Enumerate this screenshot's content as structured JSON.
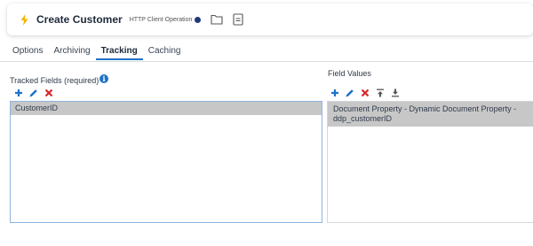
{
  "header": {
    "title": "Create Customer",
    "subtitle": "HTTP Client Operation"
  },
  "tabs": [
    {
      "label": "Options",
      "active": false
    },
    {
      "label": "Archiving",
      "active": false
    },
    {
      "label": "Tracking",
      "active": true
    },
    {
      "label": "Caching",
      "active": false
    }
  ],
  "tracked_fields": {
    "label": "Tracked Fields (required)",
    "items": [
      "CustomerID"
    ]
  },
  "field_values": {
    "label": "Field Values",
    "items": [
      "Document Property - Dynamic Document Property - ddp_customerID"
    ]
  },
  "colors": {
    "accent": "#1e72c8",
    "bolt": "#f5b400",
    "delete": "#d9262c",
    "selected_row": "#c7c7c7"
  }
}
